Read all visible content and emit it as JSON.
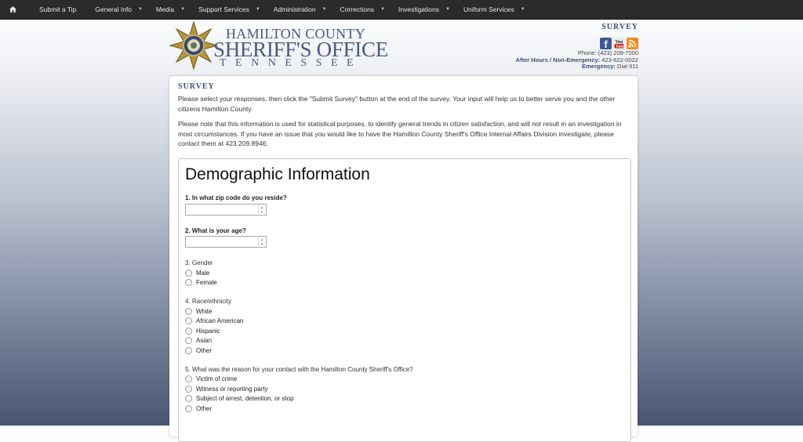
{
  "nav": {
    "items": [
      {
        "label": "Submit a Tip",
        "dropdown": false
      },
      {
        "label": "General Info",
        "dropdown": true
      },
      {
        "label": "Media",
        "dropdown": true
      },
      {
        "label": "Support Services",
        "dropdown": true
      },
      {
        "label": "Administration",
        "dropdown": true
      },
      {
        "label": "Corrections",
        "dropdown": true
      },
      {
        "label": "Investigations",
        "dropdown": true
      },
      {
        "label": "Uniform Services",
        "dropdown": true
      }
    ]
  },
  "header": {
    "logo_line1": "HAMILTON COUNTY",
    "logo_line2": "SHERIFF'S OFFICE",
    "logo_line3": "TENNESSEE",
    "page_label": "SURVEY",
    "phone_label": "Phone:",
    "phone": "(423) 209-7000",
    "after_hours_label": "After Hours / Non-Emergency:",
    "after_hours": "423-622-0022",
    "emergency_label": "Emergency:",
    "emergency": "Dial 911",
    "social": [
      "facebook-icon",
      "youtube-icon",
      "rss-icon"
    ]
  },
  "content": {
    "title": "SURVEY",
    "para1": "Please select your responses, then click the \"Submit Survey\" button at the end of the survey. Your input will help us to better serve you and the other citizens Hamilton County.",
    "para2": "Please note that this information is used for statistical purposes, to identify general trends in citizen satisfaction, and will not result in an investigation in most circumstances. If you have an issue that you would like to have the Hamilton County Sheriff's Office Internal Affairs Division investigate, please contact them at 423.209.8946."
  },
  "form": {
    "title": "Demographic Information",
    "q1": {
      "label": "1. In what zip code do you reside?",
      "value": ""
    },
    "q2": {
      "label": "2. What is your age?",
      "value": ""
    },
    "q3": {
      "label": "3. Gender",
      "options": [
        "Male",
        "Female"
      ]
    },
    "q4": {
      "label": "4. Race/ethnicity",
      "options": [
        "White",
        "African American",
        "Hispanic",
        "Asian",
        "Other"
      ]
    },
    "q5": {
      "label": "5. What was the reason for your contact with the Hamilton County Sheriff's Office?",
      "options": [
        "Victim of crime",
        "Witness or reporting party",
        "Subject of arrest, detention, or stop",
        "Other"
      ]
    }
  }
}
